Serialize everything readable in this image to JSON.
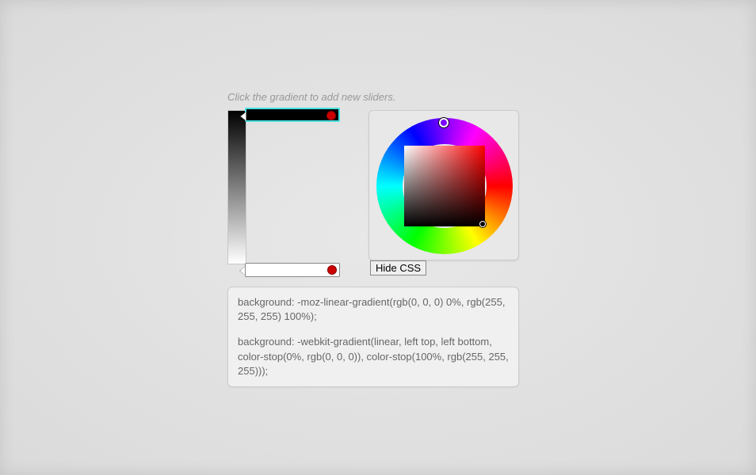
{
  "instruction": "Click the gradient to add new sliders.",
  "gradient": {
    "stops": [
      {
        "position": 0,
        "color": "rgb(0, 0, 0)",
        "selected": true
      },
      {
        "position": 100,
        "color": "rgb(255, 255, 255)",
        "selected": false
      }
    ]
  },
  "color_picker": {
    "hue": 0,
    "saturation": 100,
    "value": 0,
    "current_color": "#000000"
  },
  "toggle_button": "Hide CSS",
  "css_output": {
    "moz": "background: -moz-linear-gradient(rgb(0, 0, 0) 0%, rgb(255, 255, 255) 100%);",
    "webkit": "background: -webkit-gradient(linear, left top, left bottom, color-stop(0%, rgb(0, 0, 0)), color-stop(100%, rgb(255, 255, 255)));"
  }
}
